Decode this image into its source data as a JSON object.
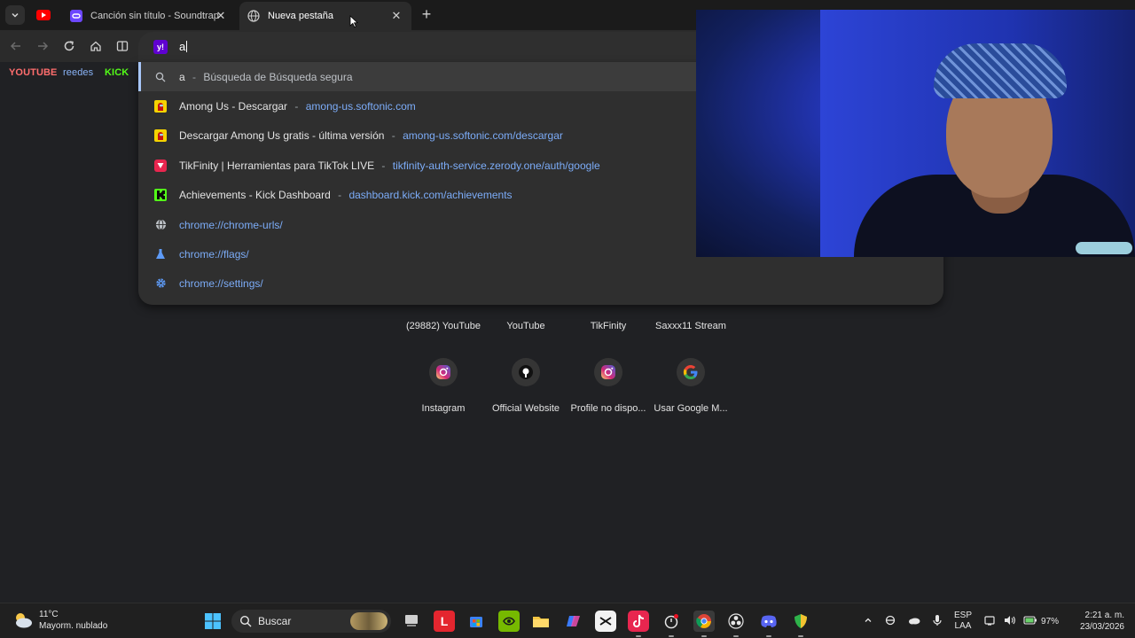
{
  "tabs": [
    {
      "title": "Canción sin título - Soundtrap",
      "favicon": "soundtrap-icon",
      "active": false
    },
    {
      "title": "Nueva pestaña",
      "favicon": "globe-icon",
      "active": true
    }
  ],
  "omnibox": {
    "value": "a",
    "search_engine": "yahoo"
  },
  "bookmarks": [
    {
      "label": "YOUTUBE",
      "color": "#ff6d6d"
    },
    {
      "label": "reedes",
      "color": "#8ab4f8"
    },
    {
      "label": "KICK",
      "color": "#53fc18"
    }
  ],
  "suggestions": [
    {
      "type": "search",
      "icon": "search-icon",
      "main": "a",
      "sep": "-",
      "desc": "Búsqueda de Búsqueda segura"
    },
    {
      "type": "history",
      "icon": "among-us-icon",
      "main": "Among Us - Descargar",
      "sep": "-",
      "url": "among-us.softonic.com"
    },
    {
      "type": "history",
      "icon": "among-us-icon",
      "main": "Descargar Among Us gratis - última versión",
      "sep": "-",
      "url": "among-us.softonic.com/descargar"
    },
    {
      "type": "history",
      "icon": "tikfinity-icon",
      "main": "TikFinity | Herramientas para TikTok LIVE",
      "sep": "-",
      "url": "tikfinity-auth-service.zerody.one/auth/google"
    },
    {
      "type": "history",
      "icon": "kick-icon",
      "main": "Achievements - Kick Dashboard",
      "sep": "-",
      "url": "dashboard.kick.com/achievements"
    },
    {
      "type": "url",
      "icon": "globe-icon",
      "url": "chrome://chrome-urls/"
    },
    {
      "type": "url",
      "icon": "flask-icon",
      "url": "chrome://flags/"
    },
    {
      "type": "url",
      "icon": "gear-icon",
      "url": "chrome://settings/"
    }
  ],
  "shortcuts_row1": [
    "(29882) YouTube",
    "YouTube",
    "TikFinity",
    "Saxxx11 Stream"
  ],
  "shortcuts_row2": [
    {
      "label": "Instagram",
      "icon": "instagram-icon"
    },
    {
      "label": "Official Website",
      "icon": "website-icon"
    },
    {
      "label": "Profile no dispo...",
      "icon": "instagram-icon"
    },
    {
      "label": "Usar Google M...",
      "icon": "google-icon"
    }
  ],
  "taskbar": {
    "weather_temp": "11°C",
    "weather_desc": "Mayorm. nublado",
    "search_label": "Buscar",
    "lang_line1": "ESP",
    "lang_line2": "LAA",
    "battery": "97%",
    "time": "2:21 a. m.",
    "date": "23/03/2026"
  }
}
